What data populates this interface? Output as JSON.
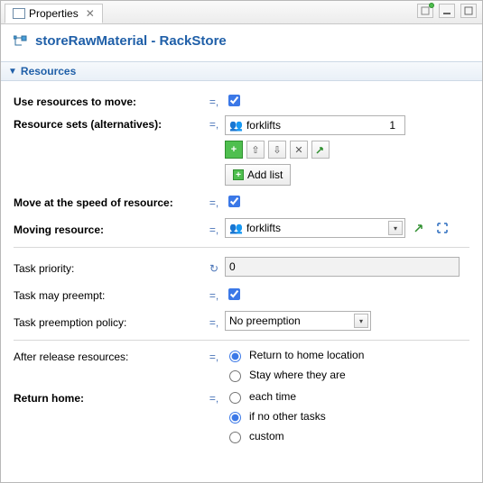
{
  "tab": {
    "title": "Properties"
  },
  "header": {
    "title": "storeRawMaterial - RackStore"
  },
  "section": {
    "title": "Resources"
  },
  "labels": {
    "use_resources": "Use resources to move:",
    "resource_sets": "Resource sets (alternatives):",
    "move_at_speed": "Move at the speed of resource:",
    "moving_resource": "Moving resource:",
    "task_priority": "Task priority:",
    "task_may_preempt": "Task may preempt:",
    "task_preemption_policy": "Task preemption policy:",
    "after_release": "After release resources:",
    "return_home": "Return home:"
  },
  "values": {
    "use_resources_checked": true,
    "resource_set_name": "forklifts",
    "resource_set_qty": "1",
    "add_list_label": "Add list",
    "move_at_speed_checked": true,
    "moving_resource": "forklifts",
    "task_priority": "0",
    "task_may_preempt_checked": true,
    "task_preemption_policy": "No preemption",
    "after_release_options": {
      "return_home": "Return to home location",
      "stay": "Stay where they are"
    },
    "after_release_selected": "return_home",
    "return_home_options": {
      "each_time": "each time",
      "if_no_other": "if no other tasks",
      "custom": "custom"
    },
    "return_home_selected": "if_no_other"
  },
  "mode_glyphs": {
    "equals": "=",
    "static": "=,",
    "loop": "↻"
  }
}
